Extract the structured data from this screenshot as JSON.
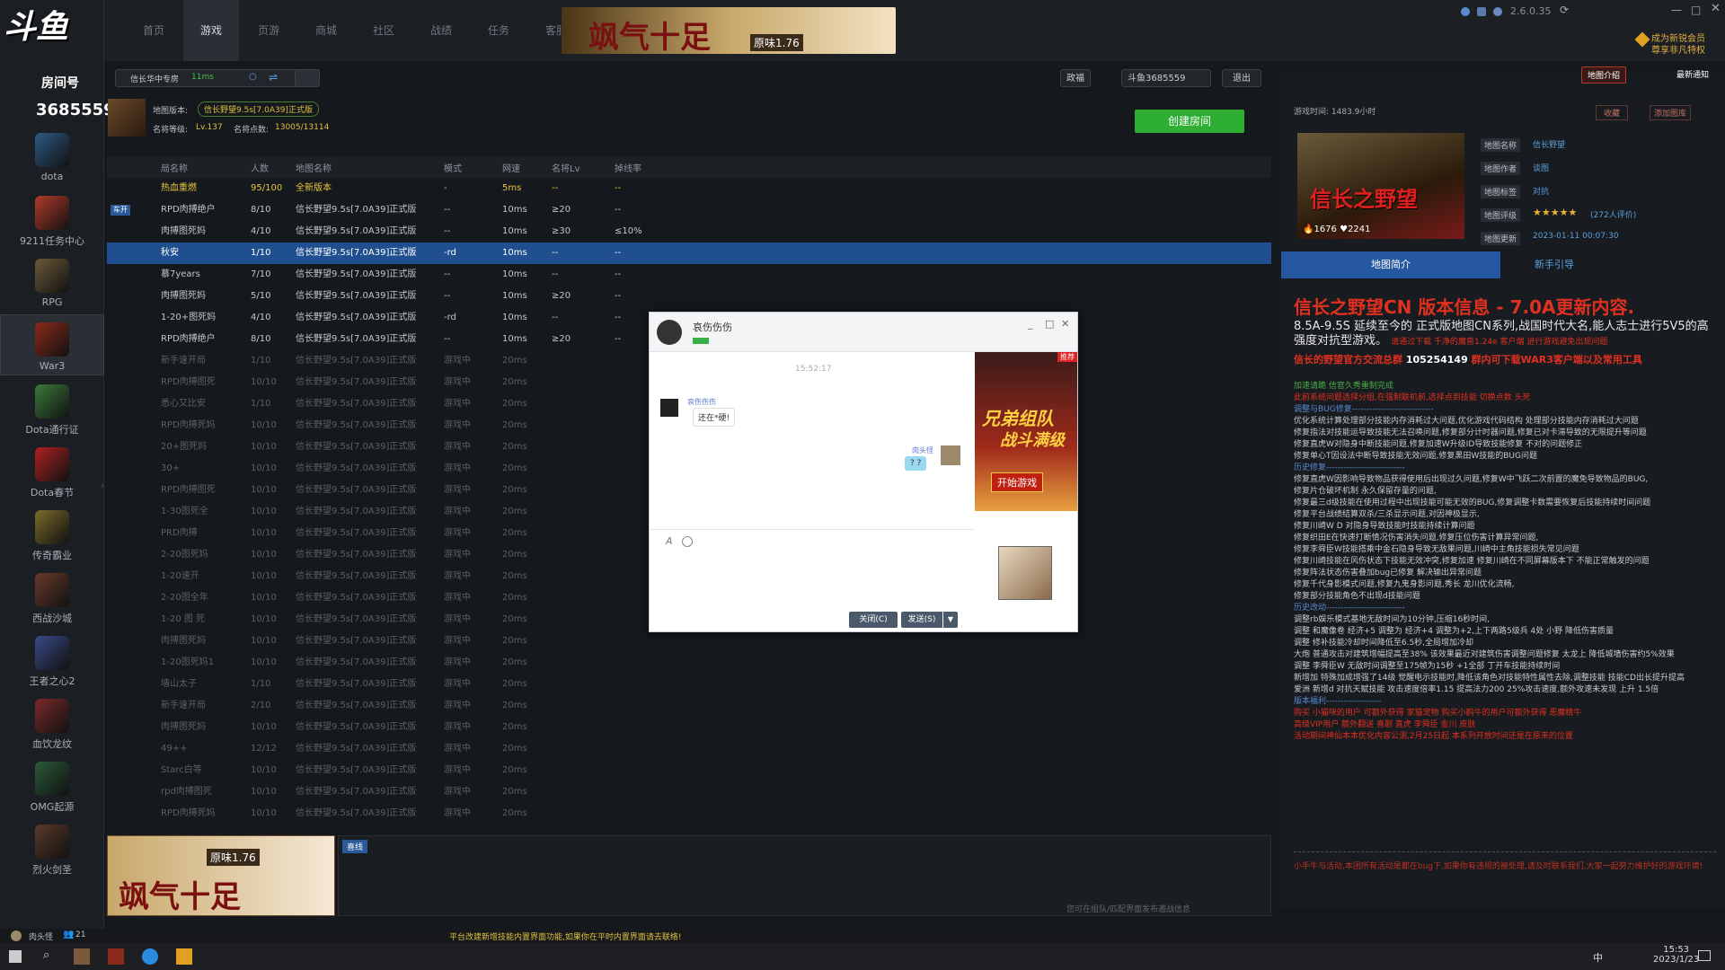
{
  "app": {
    "logo_text": "斗鱼",
    "logo_sub": "房间号",
    "room_no": "3685559",
    "version": "2.6.0.35",
    "vip": "成为新锐会员",
    "vip2": "尊享非凡特权"
  },
  "nav": [
    "首页",
    "游戏",
    "页游",
    "商城",
    "社区",
    "战绩",
    "任务",
    "客服"
  ],
  "banner_top": {
    "text": "飒气十足",
    "tag": "原味1.76"
  },
  "sidebar": [
    {
      "label": "dota",
      "color": "#2f5b86"
    },
    {
      "label": "9211任务中心",
      "color": "#b33a2a"
    },
    {
      "label": "RPG",
      "color": "#6b5a3a"
    },
    {
      "label": "War3",
      "color": "#8a2a1a"
    },
    {
      "label": "Dota通行证",
      "color": "#3a7a3a"
    },
    {
      "label": "Dota春节",
      "color": "#b02020"
    },
    {
      "label": "传奇霸业",
      "color": "#7a6a2a"
    },
    {
      "label": "西战沙城",
      "color": "#6a3a2a"
    },
    {
      "label": "王者之心2",
      "color": "#3a4a8a"
    },
    {
      "label": "血饮龙纹",
      "color": "#7a2a2a"
    },
    {
      "label": "OMG起源",
      "color": "#2a5a3a"
    },
    {
      "label": "烈火剑圣",
      "color": "#5a3a2a"
    }
  ],
  "toolbar": {
    "server": "信长华中专房",
    "ping": "11ms",
    "btn_bag": "政福",
    "user": "斗鱼3685559",
    "logout": "退出"
  },
  "mapinfo": {
    "version_label": "地图版本:",
    "version": "信长野望9.5s[7.0A39]正式版",
    "level_label": "名将等级:",
    "level": "Lv.137",
    "points_label": "名将点数:",
    "points": "13005/13114",
    "create_btn": "创建房间"
  },
  "table": {
    "headers": [
      "局名称",
      "人数",
      "地图名称",
      "模式",
      "网速",
      "名将Lv",
      "掉线率"
    ],
    "rows": [
      {
        "name": "热血重燃",
        "cnt": "95/100",
        "map": "全新版本",
        "mode": "-",
        "net": "5ms",
        "lv": "--",
        "drop": "--",
        "type": "hot"
      },
      {
        "name": "RPD肉搏绝户",
        "cnt": "8/10",
        "map": "信长野望9.5s[7.0A39]正式版",
        "mode": "--",
        "net": "10ms",
        "lv": "≥20",
        "drop": "--",
        "type": "",
        "tag": "车开"
      },
      {
        "name": "肉搏图死妈",
        "cnt": "4/10",
        "map": "信长野望9.5s[7.0A39]正式版",
        "mode": "--",
        "net": "10ms",
        "lv": "≥30",
        "drop": "≤10%",
        "type": ""
      },
      {
        "name": "秋安",
        "cnt": "1/10",
        "map": "信长野望9.5s[7.0A39]正式版",
        "mode": "-rd",
        "net": "10ms",
        "lv": "--",
        "drop": "--",
        "type": "sel"
      },
      {
        "name": "慕7years",
        "cnt": "7/10",
        "map": "信长野望9.5s[7.0A39]正式版",
        "mode": "--",
        "net": "10ms",
        "lv": "--",
        "drop": "--",
        "type": ""
      },
      {
        "name": "肉搏图死妈",
        "cnt": "5/10",
        "map": "信长野望9.5s[7.0A39]正式版",
        "mode": "--",
        "net": "10ms",
        "lv": "≥20",
        "drop": "--",
        "type": ""
      },
      {
        "name": "1-20+图死妈",
        "cnt": "4/10",
        "map": "信长野望9.5s[7.0A39]正式版",
        "mode": "-rd",
        "net": "10ms",
        "lv": "--",
        "drop": "--",
        "type": ""
      },
      {
        "name": "RPD肉搏绝户",
        "cnt": "8/10",
        "map": "信长野望9.5s[7.0A39]正式版",
        "mode": "--",
        "net": "10ms",
        "lv": "≥20",
        "drop": "--",
        "type": ""
      },
      {
        "name": "新手速开局",
        "cnt": "1/10",
        "map": "信长野望9.5s[7.0A39]正式版",
        "mode": "游戏中",
        "net": "20ms",
        "lv": "",
        "drop": "",
        "type": "dim"
      },
      {
        "name": "RPD肉搏图死",
        "cnt": "10/10",
        "map": "信长野望9.5s[7.0A39]正式版",
        "mode": "游戏中",
        "net": "20ms",
        "lv": "",
        "drop": "",
        "type": "dim"
      },
      {
        "name": "悉心又比安",
        "cnt": "1/10",
        "map": "信长野望9.5s[7.0A39]正式版",
        "mode": "游戏中",
        "net": "20ms",
        "lv": "",
        "drop": "",
        "type": "dim"
      },
      {
        "name": "RPD肉搏死妈",
        "cnt": "10/10",
        "map": "信长野望9.5s[7.0A39]正式版",
        "mode": "游戏中",
        "net": "20ms",
        "lv": "",
        "drop": "",
        "type": "dim"
      },
      {
        "name": "20+图死妈",
        "cnt": "10/10",
        "map": "信长野望9.5s[7.0A39]正式版",
        "mode": "游戏中",
        "net": "20ms",
        "lv": "",
        "drop": "",
        "type": "dim"
      },
      {
        "name": "30+",
        "cnt": "10/10",
        "map": "信长野望9.5s[7.0A39]正式版",
        "mode": "游戏中",
        "net": "20ms",
        "lv": "",
        "drop": "",
        "type": "dim"
      },
      {
        "name": "RPD肉搏图死",
        "cnt": "10/10",
        "map": "信长野望9.5s[7.0A39]正式版",
        "mode": "游戏中",
        "net": "20ms",
        "lv": "",
        "drop": "",
        "type": "dim"
      },
      {
        "name": "1-30图死全",
        "cnt": "10/10",
        "map": "信长野望9.5s[7.0A39]正式版",
        "mode": "游戏中",
        "net": "20ms",
        "lv": "",
        "drop": "",
        "type": "dim"
      },
      {
        "name": "PRD肉搏",
        "cnt": "10/10",
        "map": "信长野望9.5s[7.0A39]正式版",
        "mode": "游戏中",
        "net": "20ms",
        "lv": "",
        "drop": "",
        "type": "dim"
      },
      {
        "name": "2-20图死妈",
        "cnt": "10/10",
        "map": "信长野望9.5s[7.0A39]正式版",
        "mode": "游戏中",
        "net": "20ms",
        "lv": "",
        "drop": "",
        "type": "dim"
      },
      {
        "name": "1-20速开",
        "cnt": "10/10",
        "map": "信长野望9.5s[7.0A39]正式版",
        "mode": "游戏中",
        "net": "20ms",
        "lv": "",
        "drop": "",
        "type": "dim"
      },
      {
        "name": "2-20图全年",
        "cnt": "10/10",
        "map": "信长野望9.5s[7.0A39]正式版",
        "mode": "游戏中",
        "net": "20ms",
        "lv": "",
        "drop": "",
        "type": "dim"
      },
      {
        "name": "1-20 图 死",
        "cnt": "10/10",
        "map": "信长野望9.5s[7.0A39]正式版",
        "mode": "游戏中",
        "net": "20ms",
        "lv": "",
        "drop": "",
        "type": "dim"
      },
      {
        "name": "肉搏图死妈",
        "cnt": "10/10",
        "map": "信长野望9.5s[7.0A39]正式版",
        "mode": "游戏中",
        "net": "20ms",
        "lv": "",
        "drop": "",
        "type": "dim"
      },
      {
        "name": "1-20图死妈1",
        "cnt": "10/10",
        "map": "信长野望9.5s[7.0A39]正式版",
        "mode": "游戏中",
        "net": "20ms",
        "lv": "",
        "drop": "",
        "type": "dim"
      },
      {
        "name": "墙山太子",
        "cnt": "1/10",
        "map": "信长野望9.5s[7.0A39]正式版",
        "mode": "游戏中",
        "net": "20ms",
        "lv": "",
        "drop": "",
        "type": "dim"
      },
      {
        "name": "新手速开局",
        "cnt": "2/10",
        "map": "信长野望9.5s[7.0A39]正式版",
        "mode": "游戏中",
        "net": "20ms",
        "lv": "",
        "drop": "",
        "type": "dim"
      },
      {
        "name": "肉搏图死妈",
        "cnt": "10/10",
        "map": "信长野望9.5s[7.0A39]正式版",
        "mode": "游戏中",
        "net": "20ms",
        "lv": "",
        "drop": "",
        "type": "dim"
      },
      {
        "name": "49++",
        "cnt": "12/12",
        "map": "信长野望9.5s[7.0A39]正式版",
        "mode": "游戏中",
        "net": "20ms",
        "lv": "",
        "drop": "",
        "type": "dim"
      },
      {
        "name": "Starc白等",
        "cnt": "10/10",
        "map": "信长野望9.5s[7.0A39]正式版",
        "mode": "游戏中",
        "net": "20ms",
        "lv": "",
        "drop": "",
        "type": "dim"
      },
      {
        "name": "rpd肉搏图死",
        "cnt": "10/10",
        "map": "信长野望9.5s[7.0A39]正式版",
        "mode": "游戏中",
        "net": "20ms",
        "lv": "",
        "drop": "",
        "type": "dim"
      },
      {
        "name": "RPD肉搏死妈",
        "cnt": "10/10",
        "map": "信长野望9.5s[7.0A39]正式版",
        "mode": "游戏中",
        "net": "20ms",
        "lv": "",
        "drop": "",
        "type": "dim"
      }
    ]
  },
  "chat": {
    "title": "哀伤伤伤",
    "time": "15:52:17",
    "sender1": "哀伤伤伤",
    "msg1": "还在*硬!",
    "sender2": "肉头怪",
    "msg2": "? ?",
    "close_btn": "关闭(C)",
    "send_btn": "发送(S)",
    "ad_badge": "推荐",
    "ad_title": "兄弟组队",
    "ad_sub": "战斗满级",
    "ad_btn": "开始游戏"
  },
  "bottom": {
    "tab": "喜线",
    "hint": "您可在组队/匹配界面发布邀战信息",
    "banner_text": "飒气十足",
    "banner_tag": "原味1.76"
  },
  "right": {
    "top_btns": [
      "地图介绍",
      "最新通知"
    ],
    "time_label": "游戏时间:",
    "time": "1483.9小时",
    "fav": "收藏",
    "add": "添加图库",
    "poster_title": "信长之野望",
    "likes": "1676",
    "hearts": "2241",
    "info": [
      {
        "k": "地图名称",
        "v": "信长野望"
      },
      {
        "k": "地图作者",
        "v": "谈图"
      },
      {
        "k": "地图标签",
        "v": "对抗"
      },
      {
        "k": "地图评级",
        "v": "(272人评价)"
      },
      {
        "k": "地图更新",
        "v": "2023-01-11 00:07:30"
      }
    ],
    "tab1": "地图简介",
    "tab2": "新手引导",
    "headline": "信长之野望CN 版本信息 - 7.0A更新内容.",
    "desc1": "8.5A-9.5S 延续至今的 正式版地图CN系列,战国时代大名,能人志士进行5V5的高强度对抗型游戏。",
    "desc1b": "请通过下载 千净的魔兽1.24e 客户端 进行游戏避免出现问题",
    "desc2": "信长的野望官方交流总群",
    "group": "105254149",
    "desc2b": "群内可下载WAR3客户端以及常用工具",
    "lines": [
      "加速请跪 信官久秀重制完成",
      "此前系统问题选择分组,在强制联机前,选择点到技能 切换点数 头死",
      "调整与BUG修复----------------------------",
      "优化系统计算处理部分技能内存消耗过大问题,优化游戏代码结构 处理部分技能内存消耗过大问题",
      "修复指法对技能运导致技能无法召唤问题,修复部分计时器问题,修复已对卡滞导致的无限提升等问题",
      "修复直虎W对隐身中断技能问题,修复加速W升级ID导致技能修复 不对的问题修正",
      "修复单心T因设法中断导致技能无效问题,修复黑田W技能的BUG问题",
      "历史修复---------------------------",
      "修复直虎W因影响导致物品获得使用后出现过久问题,修复W中飞跃二次前置的魔免导致物品的BUG,",
      "修复片仓破坏机制 永久保留存量的问题,",
      "修复最三d级技能在使用过程中出现技能可能无效的BUG,修复调整卡数需要恢复后技能持续时间问题",
      "修复平台战绩结算双杀/三杀显示问题,对因神极显示,",
      "修复川崎W D 对隐身导致技能时技能持续计算问题",
      "修复织田E在快速打断情况伤害消失问题,修复压位伤害计算异常问题,",
      "修复李舜臣W技能搭乘中金石隐身导致无敌果问题,川崎中主角技能损失常见问题",
      "修复川崎技能在风伤状态下技能无效冲突,修复加速 修复川崎在不同屏幕版本下 不能正常触发的问题",
      "修复阵法状态伤害叠加bug已修复 解决输出异常问题",
      "修复千代身影模式问题,修复九鬼身影问题,秀长 龙川优化流畅,",
      "修复部分技能角色不出现d技能问题",
      "历史改动---------------------------",
      "调整rb娱乐模式基地无敌时间为10分钟,压缩16秒时间,",
      "调整 和魔像卷 经济+5 调整为 经济+4 调整为+2,上下两路5级兵 4处 小野 降低伤害质量",
      "调整 修补技能冷却时间降低至6.5秒,全局增加冷却",
      "大炮 普通攻击对建筑增幅提高至38% 该效果最近对建筑伤害调整问题修复 太龙上 降低城墙伤害约5%效果",
      "调整 李舜臣W 无敌时间调整至175帧为15秒 +1全部 丁开车技能持续时间",
      "新增加 特殊加成增强了14级 觉醒电示技能时,降低该角色对技能特性属性去除,调整技能 技能CD出长提升提高",
      "爱洲 新增d 对抗天赋技能 攻击速度倍率1.15 提高法力200 25%攻击速度,额外攻速未发现 上升 1.5倍",
      "版本福利-------------------",
      "购买 小猫咪的用户 可额外获得 家猫宠物 购买小鹤牛的用户可额外获得 恶魔精牛",
      "高级VIP用户 额外翻送 喜剧 直虎 李舜臣 金川 皮肤",
      "活动期间神仙本本优化内容公测,2月25日起 本系列开放时间还是在原来的位置"
    ],
    "footer": "小手牛与活动,本团所有活动是都在bug下,如果你有违规的被处理,请及时联系我们,大家一起努力维护好的游戏环境!"
  },
  "status": {
    "nick": "肉头怪",
    "count": "21",
    "notice": "平台改建新增技能内置界面功能,如果你在平时内置界面请去联络!"
  },
  "taskbar": {
    "time": "15:53",
    "date": "2023/1/23",
    "ime": "中"
  }
}
